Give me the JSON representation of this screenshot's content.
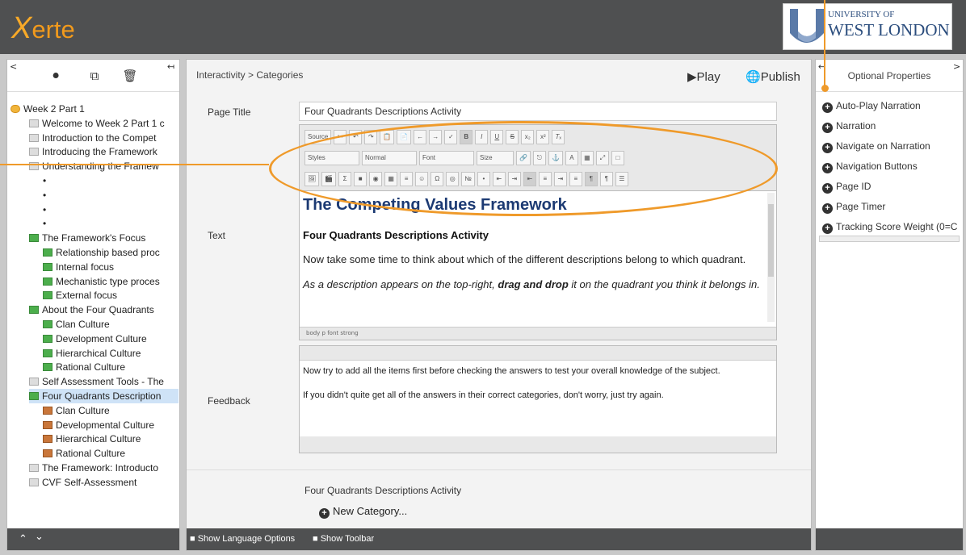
{
  "header": {
    "logo_x": "X",
    "logo_rest": "erte",
    "uni_line1": "UNIVERSITY OF",
    "uni_line2": "WEST LONDON"
  },
  "left_panel": {
    "tools": [
      "add-icon",
      "copy-icon",
      "delete-icon"
    ],
    "tree": [
      {
        "label": "Week 2 Part 1",
        "icon": "folder"
      },
      {
        "label": "Welcome to Week 2 Part 1 c",
        "icon": "page"
      },
      {
        "label": "Introduction to the Compet",
        "icon": "page"
      },
      {
        "label": "Introducing the Framework",
        "icon": "page"
      },
      {
        "label": "Understanding the Framew",
        "icon": "page"
      },
      {
        "label": "",
        "icon": "bullet"
      },
      {
        "label": "",
        "icon": "bullet"
      },
      {
        "label": "",
        "icon": "bullet"
      },
      {
        "label": "",
        "icon": "bullet"
      },
      {
        "label": "The Framework's Focus",
        "icon": "green"
      },
      {
        "label": "Relationship based proc",
        "icon": "green"
      },
      {
        "label": "Internal focus",
        "icon": "green"
      },
      {
        "label": "Mechanistic type proces",
        "icon": "green"
      },
      {
        "label": "External focus",
        "icon": "green"
      },
      {
        "label": "About the Four Quadrants",
        "icon": "green"
      },
      {
        "label": "Clan Culture",
        "icon": "green"
      },
      {
        "label": "Development Culture",
        "icon": "green"
      },
      {
        "label": "Hierarchical Culture",
        "icon": "green"
      },
      {
        "label": "Rational Culture",
        "icon": "green"
      },
      {
        "label": "Self Assessment Tools - The",
        "icon": "page"
      },
      {
        "label": "Four Quadrants Description",
        "icon": "green"
      },
      {
        "label": "Clan Culture",
        "icon": "puzzle"
      },
      {
        "label": "Developmental Culture",
        "icon": "puzzle"
      },
      {
        "label": "Hierarchical Culture",
        "icon": "puzzle"
      },
      {
        "label": "Rational Culture",
        "icon": "puzzle"
      },
      {
        "label": "The Framework: Introducto",
        "icon": "page"
      },
      {
        "label": "CVF Self-Assessment",
        "icon": "page"
      }
    ]
  },
  "center": {
    "breadcrumb": "Interactivity > Categories",
    "play": "Play",
    "publish": "Publish",
    "page_title_label": "Page Title",
    "page_title_value": "Four Quadrants Descriptions Activity",
    "text_label": "Text",
    "feedback_label": "Feedback",
    "toolbar": {
      "source": "Source",
      "styles": "Styles",
      "format": "Normal",
      "font": "Font",
      "size": "Size"
    },
    "content": {
      "h1": "The Competing Values Framework",
      "h3": "Four Quadrants Descriptions Activity",
      "p1": "Now take some time to think about which of the different descriptions belong to which quadrant.",
      "p2a": "As a description appears on the top-right, ",
      "p2b": "drag and drop",
      "p2c": " it on the quadrant you think it belongs in."
    },
    "pathbar": "body  p  font  strong",
    "feedback_text": [
      "Now try to add all the items first before checking the answers to test your overall knowledge of the subject.",
      "If you didn't quite get all of the answers in their correct categories, don't worry, just try again."
    ],
    "category_title": "Four Quadrants Descriptions Activity",
    "new_category": "New Category...",
    "bottom": {
      "lang": "Show Language Options",
      "toolbar": "Show Toolbar"
    }
  },
  "right_panel": {
    "title": "Optional Properties",
    "options": [
      "Auto-Play Narration",
      "Narration",
      "Navigate on Narration",
      "Navigation Buttons",
      "Page ID",
      "Page Timer",
      "Tracking Score Weight (0=C"
    ]
  },
  "colors": {
    "header": "#4f5051",
    "accent": "#ef9a2a",
    "brand": "#f29a1c"
  }
}
